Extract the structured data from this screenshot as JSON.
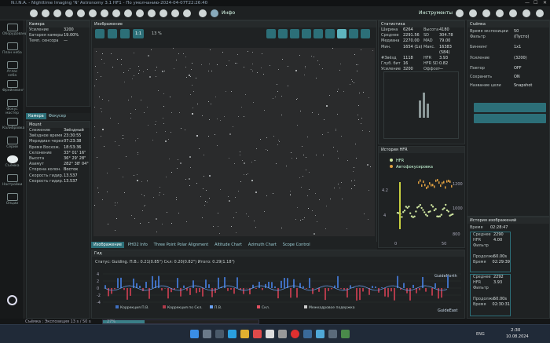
{
  "window": {
    "title": "N.I.N.A. - Nighttime Imaging 'N' Astronomy 3.1 HF1 - По умолчанию-2024-04-07T22:26:40",
    "min": "—",
    "max": "☐",
    "close": "✕"
  },
  "appbar": {
    "info_label": "Инфо",
    "tools_label": "Инструменты"
  },
  "sidebar": {
    "items": [
      {
        "label": "Оборудование"
      },
      {
        "label": "План неба"
      },
      {
        "label": "Атлас неба"
      },
      {
        "label": "Фреймминг"
      },
      {
        "label": "Фокус мастер"
      },
      {
        "label": "Калибровка"
      },
      {
        "label": "Серии"
      },
      {
        "label": "Съёмка"
      },
      {
        "label": "Настройки"
      },
      {
        "label": "Опции"
      }
    ],
    "active": "Съёмка"
  },
  "camera": {
    "title": "Камера",
    "rows": [
      {
        "k": "Усиление",
        "v": "3200"
      },
      {
        "k": "Батарея камеры",
        "v": "19.00%"
      },
      {
        "k": "Темп. сенсора",
        "v": "—"
      }
    ]
  },
  "tabs1": {
    "a": "Камера",
    "b": "Фокусер"
  },
  "mount": {
    "title": "Mount",
    "rows": [
      {
        "k": "Слежение",
        "v": "Звёздный"
      },
      {
        "k": "Звёздное время",
        "v": "23:30:55"
      },
      {
        "k": "Меридиан через",
        "v": "07:23:38"
      },
      {
        "k": "Время Восхож.",
        "v": "18:53:36"
      },
      {
        "k": "Склонение",
        "v": "33° 01' 16\""
      },
      {
        "k": "Высота",
        "v": "36° 29' 28\""
      },
      {
        "k": "Азимут",
        "v": "282° 38' 04\""
      },
      {
        "k": "Сторона колон.",
        "v": "Восток"
      },
      {
        "k": "Скорость гидир.",
        "v": "13.537"
      },
      {
        "k": "Скорость гидир.",
        "v": "13.537"
      }
    ]
  },
  "image": {
    "title": "Изображение",
    "zoom_fit": "1:1",
    "zoom_pct": "13 %"
  },
  "bottom_tabs": [
    "Изображение",
    "PHD2 Info",
    "Three Point Polar Alignment",
    "Altitude Chart",
    "Azimuth Chart",
    "Scope Control"
  ],
  "stats": {
    "title": "Статистика",
    "rows": [
      {
        "k": "Ширина",
        "v": "6264",
        "k2": "Высота",
        "v2": "4180"
      },
      {
        "k": "Среднее",
        "v": "2291.56",
        "k2": "SD",
        "v2": "304.78"
      },
      {
        "k": "Медиана",
        "v": "2270.00",
        "k2": "MAD",
        "v2": "79.00"
      },
      {
        "k": "Мин.",
        "v": "1654 (1x)",
        "k2": "Макс.",
        "v2": "16383 (584)"
      },
      {
        "k": "#Звёзд",
        "v": "1118",
        "k2": "HFR",
        "v2": "3.93"
      },
      {
        "k": "Глуб. бит",
        "v": "16",
        "k2": "HFR SD",
        "v2": "0.82"
      },
      {
        "k": "Усиление",
        "v": "3200",
        "k2": "Оффсет",
        "v2": "—"
      }
    ]
  },
  "hfr": {
    "title": "История HFR",
    "legend_hfr": "HFR",
    "legend_af": "Автофокусировка",
    "y_left_top": "4.2",
    "y_left_mid": "4",
    "y_right_top": "1200",
    "y_right_mid": "1000",
    "y_right_bot": "800",
    "x0": "0",
    "x50": "50"
  },
  "guide": {
    "title": "Гид",
    "status": "Статус: Guiding. П.В.: 0.21(0.85\") Скл: 0.20(0.82\") Итого: 0.29(1.18\")",
    "north": "GuideNorth",
    "east": "GuideEast",
    "y_labels": [
      "4",
      "2",
      "0",
      "-2",
      "-4"
    ],
    "legend": [
      "Коррекция П.В.",
      "Коррекция по Скл.",
      "П.В.",
      "Скл.",
      "Межкадровое подержка"
    ]
  },
  "capture": {
    "title": "Съёмка",
    "rows": [
      {
        "k": "Время экспозиции",
        "v": "50"
      },
      {
        "k": "Фильтр",
        "v": "(Пусто)"
      },
      {
        "k": "Биннинг",
        "v": "1x1"
      },
      {
        "k": "Усиление",
        "v": "(3200)"
      },
      {
        "k": "Повтор",
        "v": "OFF"
      },
      {
        "k": "Сохранить",
        "v": "ON"
      },
      {
        "k": "Название цели",
        "v": "Snapshot"
      }
    ]
  },
  "history": {
    "title": "История изображений",
    "items": [
      {
        "time_k": "Время",
        "time_v": "02:28:47"
      },
      {
        "mean_k": "Среднее",
        "mean_v": "2290",
        "hfr_k": "HFR",
        "hfr_v": "4.00",
        "f_k": "Фильтр",
        "dur_k": "Продолжи",
        "dur_v": "50.00s",
        "time_k": "Время",
        "time_v": "02:29:39"
      },
      {
        "mean_k": "Среднее",
        "mean_v": "2292",
        "hfr_k": "HFR",
        "hfr_v": "3.93",
        "f_k": "Фильтр",
        "dur_k": "Продолжи",
        "dur_v": "50.00s",
        "time_k": "Время",
        "time_v": "02:30:31"
      }
    ]
  },
  "status": {
    "text": "Съёмка : Экспозиция 13 s / 50 s",
    "pct": "27%"
  },
  "taskbar": {
    "lang": "ENG",
    "time": "2:30",
    "date": "10.08.2024"
  }
}
